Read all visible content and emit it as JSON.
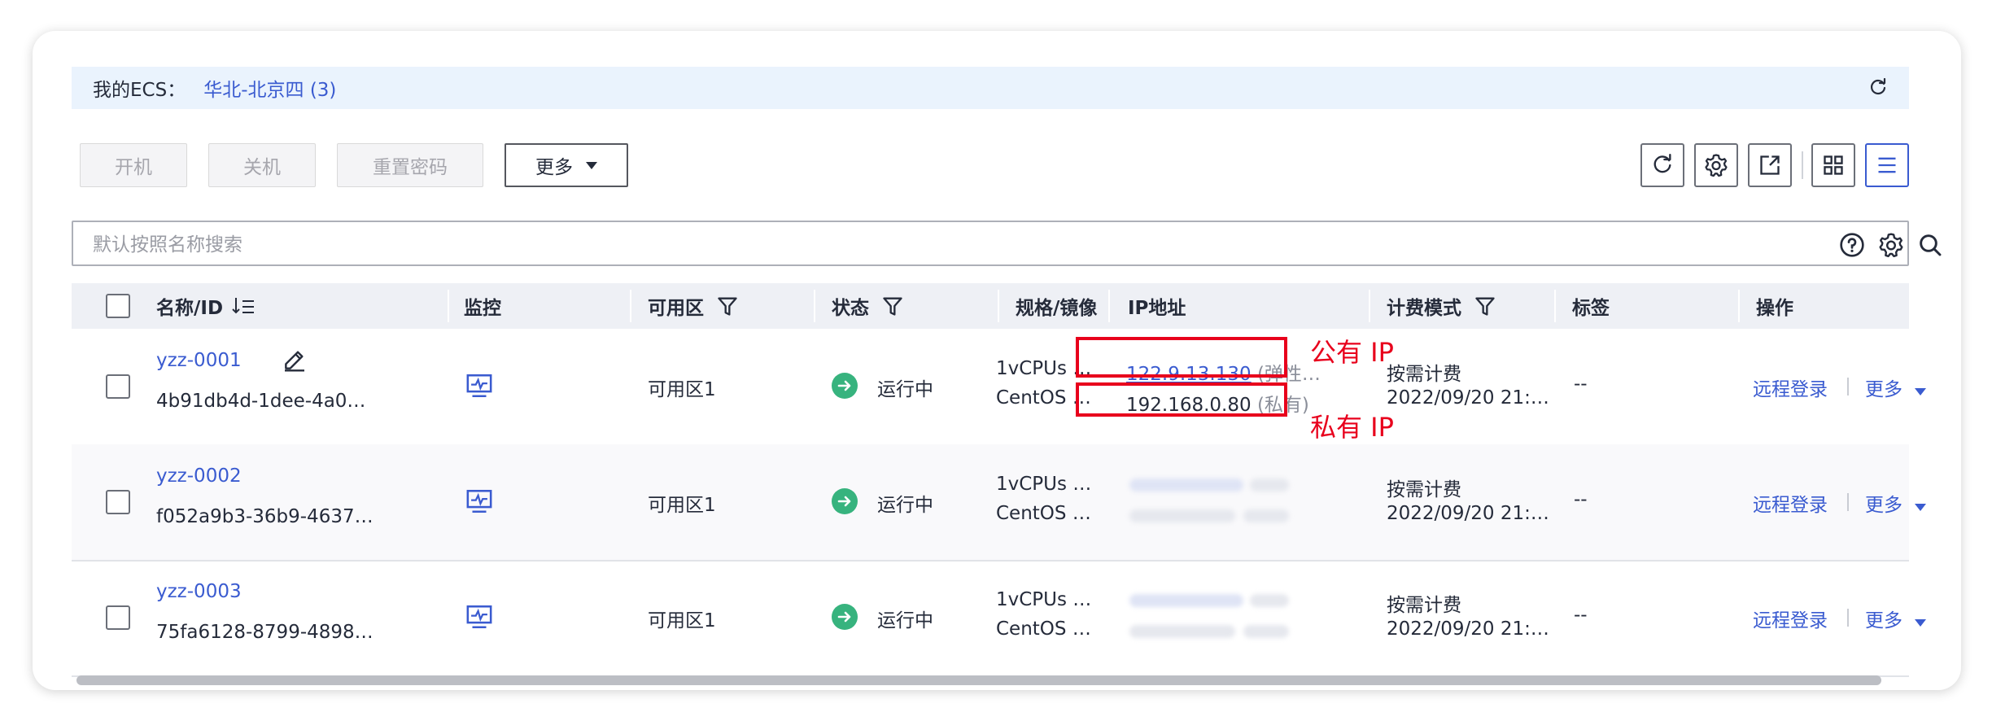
{
  "region": {
    "label": "我的ECS：",
    "value": "华北-北京四 (3)"
  },
  "toolbar": {
    "start": "开机",
    "stop": "关机",
    "reset_password": "重置密码",
    "more": "更多"
  },
  "search": {
    "placeholder": "默认按照名称搜索"
  },
  "columns": {
    "name": "名称/ID",
    "monitor": "监控",
    "az": "可用区",
    "status": "状态",
    "spec": "规格/镜像",
    "ip": "IP地址",
    "billing": "计费模式",
    "tags": "标签",
    "ops": "操作"
  },
  "rows": [
    {
      "name": "yzz-0001",
      "id": "4b91db4d-1dee-4a0…",
      "az": "可用区1",
      "status": "运行中",
      "spec": "1vCPUs …",
      "image": "CentOS …",
      "public_ip": "122.9.13.130",
      "public_ip_type": "(弹性…",
      "private_ip": "192.168.0.80",
      "private_ip_type": "(私有)",
      "billing": "按需计费",
      "created": "2022/09/20 21:…",
      "tags": "--",
      "remote_login": "远程登录",
      "more": "更多"
    },
    {
      "name": "yzz-0002",
      "id": "f052a9b3-36b9-4637…",
      "az": "可用区1",
      "status": "运行中",
      "spec": "1vCPUs …",
      "image": "CentOS …",
      "billing": "按需计费",
      "created": "2022/09/20 21:…",
      "tags": "--",
      "remote_login": "远程登录",
      "more": "更多"
    },
    {
      "name": "yzz-0003",
      "id": "75fa6128-8799-4898…",
      "az": "可用区1",
      "status": "运行中",
      "spec": "1vCPUs …",
      "image": "CentOS …",
      "billing": "按需计费",
      "created": "2022/09/20 21:…",
      "tags": "--",
      "remote_login": "远程登录",
      "more": "更多"
    }
  ],
  "annotations": {
    "public_ip": "公有 IP",
    "private_ip": "私有 IP"
  },
  "colors": {
    "accent": "#3a5bd0",
    "status_running": "#37b37e",
    "annotation": "#e8001c"
  }
}
